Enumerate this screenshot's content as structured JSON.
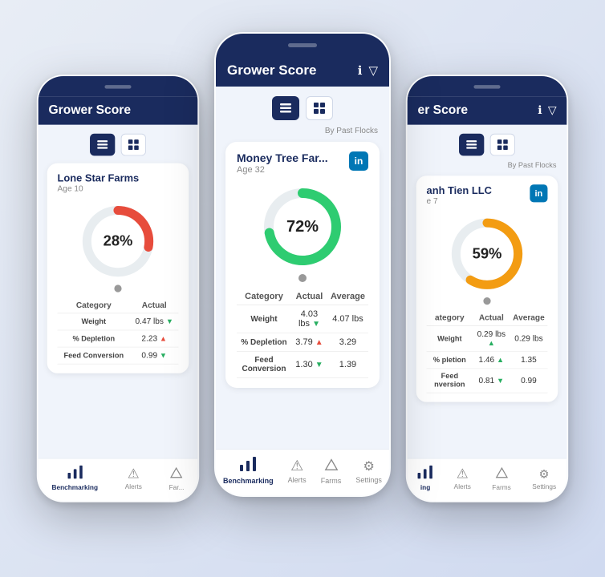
{
  "phones": [
    {
      "id": "left",
      "header": {
        "title": "Grower Score",
        "show_icons": false
      },
      "by_past_flocks": false,
      "farm": {
        "name": "Lone Star Farms",
        "age": "Age 10",
        "show_linkedin": false,
        "score_percent": 28,
        "score_label": "28%",
        "donut_color": "red",
        "table_headers": [
          "Category",
          "Actual"
        ],
        "table_rows": [
          {
            "category": "Weight",
            "actual": "0.47 lbs",
            "actual_arrow": "down",
            "average": ""
          },
          {
            "category": "% Depletion",
            "actual": "2.23",
            "actual_arrow": "up",
            "average": ""
          },
          {
            "category": "Feed Conversion",
            "actual": "0.99",
            "actual_arrow": "down",
            "average": ""
          }
        ]
      },
      "nav_items": [
        {
          "icon": "📊",
          "label": "Benchmarking",
          "active": true
        },
        {
          "icon": "⚠",
          "label": "Alerts",
          "active": false
        },
        {
          "icon": "🏠",
          "label": "Far...",
          "active": false
        }
      ]
    },
    {
      "id": "center",
      "header": {
        "title": "Grower Score",
        "show_icons": true
      },
      "by_past_flocks": true,
      "farm": {
        "name": "Money Tree Far...",
        "age": "Age 32",
        "show_linkedin": true,
        "score_percent": 72,
        "score_label": "72%",
        "donut_color": "green",
        "table_headers": [
          "Category",
          "Actual",
          "Average"
        ],
        "table_rows": [
          {
            "category": "Weight",
            "actual": "4.03 lbs",
            "actual_arrow": "down",
            "average": "4.07 lbs"
          },
          {
            "category": "% Depletion",
            "actual": "3.79",
            "actual_arrow": "up",
            "average": "3.29"
          },
          {
            "category": "Feed Conversion",
            "actual": "1.30",
            "actual_arrow": "down",
            "average": "1.39"
          }
        ]
      },
      "nav_items": [
        {
          "icon": "📊",
          "label": "Benchmarking",
          "active": true
        },
        {
          "icon": "⚠",
          "label": "Alerts",
          "active": false
        },
        {
          "icon": "🏠",
          "label": "Farms",
          "active": false
        },
        {
          "icon": "⚙",
          "label": "Settings",
          "active": false
        }
      ]
    },
    {
      "id": "right",
      "header": {
        "title": "er Score",
        "show_icons": true
      },
      "by_past_flocks": true,
      "farm": {
        "name": "anh Tien LLC",
        "age": "e 7",
        "show_linkedin": true,
        "score_percent": 59,
        "score_label": "59%",
        "donut_color": "orange",
        "table_headers": [
          "ategory",
          "Actual",
          "Average"
        ],
        "table_rows": [
          {
            "category": "Weight",
            "actual": "0.29 lbs",
            "actual_arrow": "up",
            "average": "0.29 lbs"
          },
          {
            "category": "% pletion",
            "actual": "1.46",
            "actual_arrow": "up",
            "average": "1.35"
          },
          {
            "category": "Feed nversion",
            "actual": "0.81",
            "actual_arrow": "down",
            "average": "0.99"
          }
        ]
      },
      "nav_items": [
        {
          "icon": "📊",
          "label": "ing",
          "active": true
        },
        {
          "icon": "⚠",
          "label": "Alerts",
          "active": false
        },
        {
          "icon": "🏠",
          "label": "Farms",
          "active": false
        },
        {
          "icon": "⚙",
          "label": "Settings",
          "active": false
        }
      ]
    }
  ],
  "toggle": {
    "list_label": "list",
    "grid_label": "grid"
  }
}
